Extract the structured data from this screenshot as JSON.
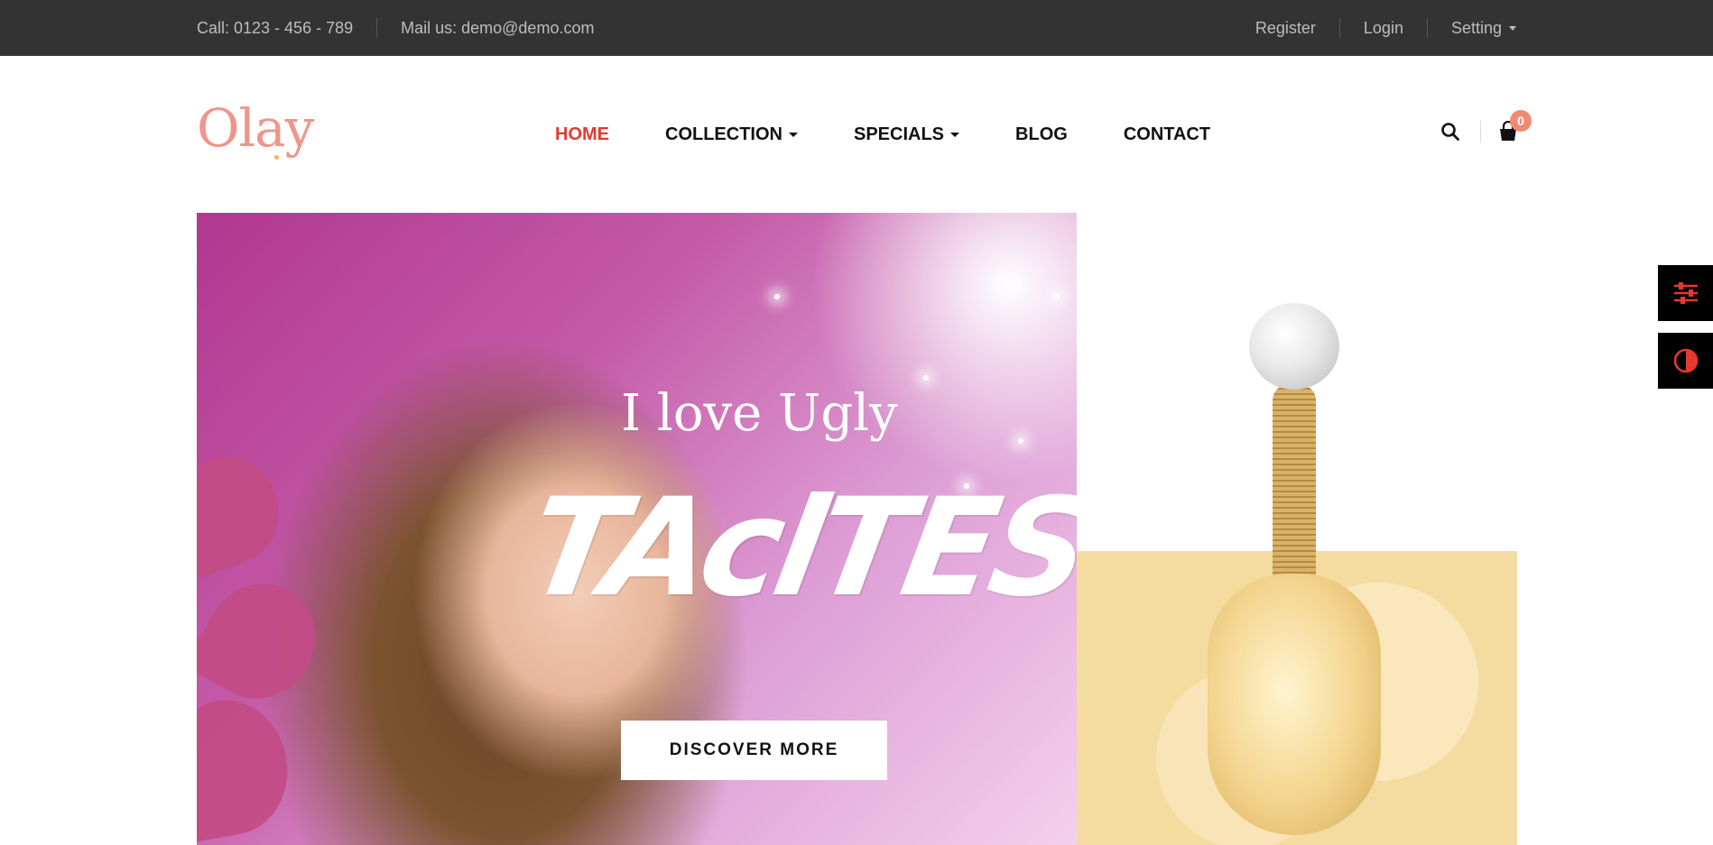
{
  "topbar": {
    "phone": "Call: 0123 - 456 - 789",
    "email": "Mail us: demo@demo.com",
    "register": "Register",
    "login": "Login",
    "setting": "Setting"
  },
  "header": {
    "logo": "Olay",
    "nav": [
      {
        "label": "HOME",
        "active": true,
        "dropdown": false
      },
      {
        "label": "COLLECTION",
        "active": false,
        "dropdown": true
      },
      {
        "label": "SPECIALS",
        "active": false,
        "dropdown": true
      },
      {
        "label": "BLOG",
        "active": false,
        "dropdown": false
      },
      {
        "label": "CONTACT",
        "active": false,
        "dropdown": false
      }
    ],
    "cart_count": "0",
    "icons": [
      "search-icon",
      "shopping-bag-icon"
    ]
  },
  "hero": {
    "subtitle": "I love Ugly",
    "title": "TAclTES",
    "button": "DISCOVER MORE"
  },
  "side_tools": [
    "sliders-icon",
    "contrast-icon"
  ],
  "colors": {
    "accent": "#e5392f",
    "topbar_bg": "#333333",
    "logo": "#f0958a",
    "badge": "#f08a72",
    "gold_panel": "#f4dba0"
  }
}
